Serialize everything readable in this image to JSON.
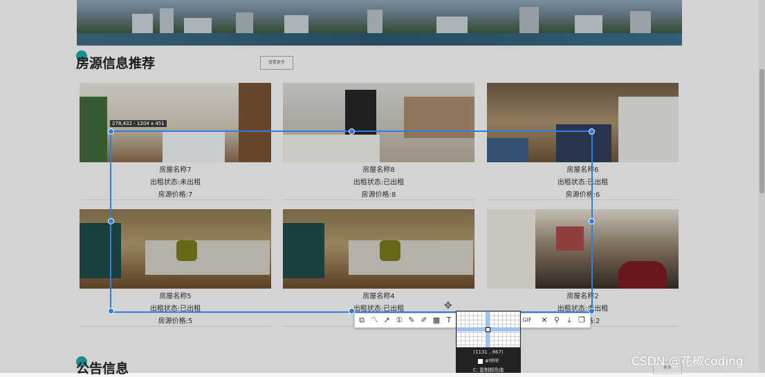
{
  "section1": {
    "title": "房源信息推荐",
    "more": "查看更多"
  },
  "section2": {
    "title": "公告信息",
    "more": "更多"
  },
  "houses": [
    {
      "name": "房屋名称7",
      "status": "出租状态:未出租",
      "price": "房源价格:7"
    },
    {
      "name": "房屋名称8",
      "status": "出租状态:已出租",
      "price": "房源价格:8"
    },
    {
      "name": "房屋名称6",
      "status": "出租状态:已出租",
      "price": "房源价格:6"
    },
    {
      "name": "房屋名称5",
      "status": "出租状态:已出租",
      "price": "房源价格:5"
    },
    {
      "name": "房屋名称4",
      "status": "出租状态:已出租",
      "price": "房源价格:4"
    },
    {
      "name": "房屋名称2",
      "status": "出租状态:未出租",
      "price": "房源价格:2"
    }
  ],
  "screenshot_tool": {
    "size_label": "278,432 - 1204 x 451",
    "gif_label": "GIF",
    "coords": "(1131 , 867)",
    "hex": "#ffffff",
    "copy_hint": "C: 复制颜色值"
  },
  "watermark": "CSDN @花椒coding",
  "colors": {
    "accent": "#21a4a4",
    "selection": "#2e7de0"
  }
}
